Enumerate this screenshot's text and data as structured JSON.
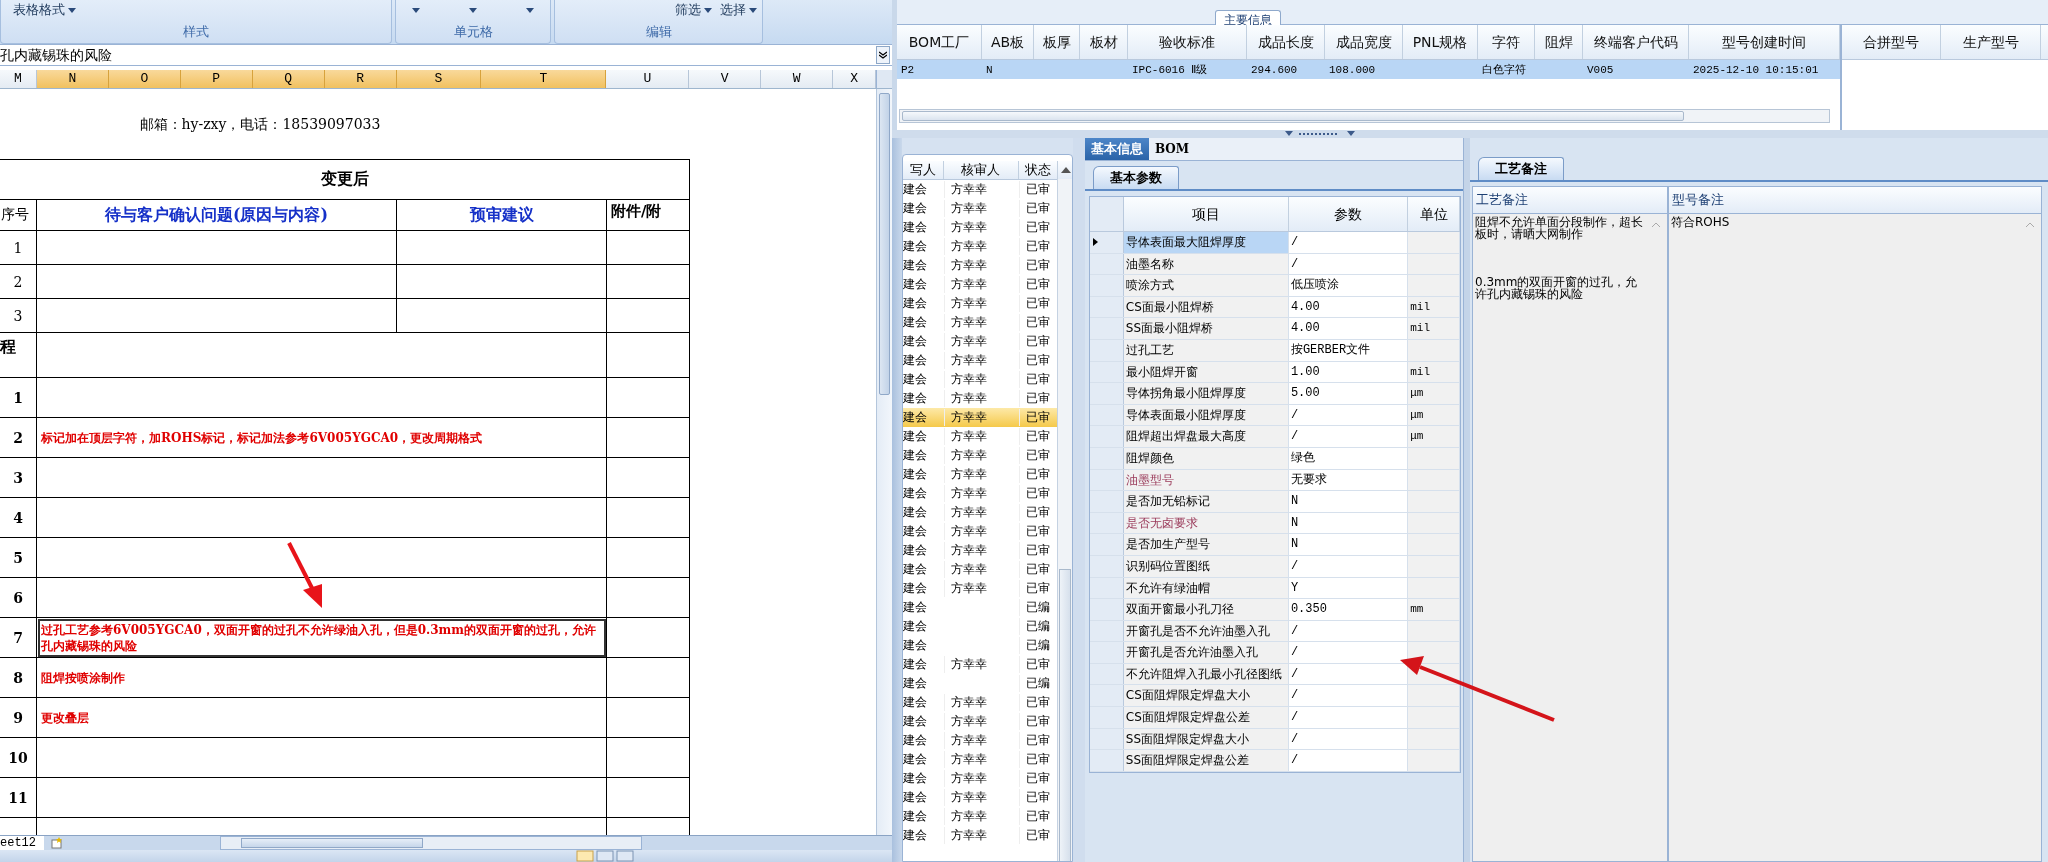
{
  "excel": {
    "ribbon": {
      "groups": [
        {
          "label": "样式",
          "commands": [
            "表格格式"
          ]
        },
        {
          "label": "单元格",
          "kind": "carets"
        },
        {
          "label": "编辑",
          "commands": [
            "筛选",
            "选择"
          ]
        }
      ]
    },
    "formula_bar": {
      "value": "孔内藏锡珠的风险"
    },
    "columns": [
      {
        "label": "M",
        "selected": false
      },
      {
        "label": "N",
        "selected": true
      },
      {
        "label": "O",
        "selected": true
      },
      {
        "label": "P",
        "selected": true
      },
      {
        "label": "Q",
        "selected": true
      },
      {
        "label": "R",
        "selected": true
      },
      {
        "label": "S",
        "selected": true
      },
      {
        "label": "T",
        "selected": true
      },
      {
        "label": "U",
        "selected": false
      },
      {
        "label": "V",
        "selected": false
      },
      {
        "label": "W",
        "selected": false
      },
      {
        "label": "X",
        "selected": false
      }
    ],
    "sheet": {
      "contact": "邮箱：hy-zxy，电话：18539097033",
      "title": "变更后",
      "headers": [
        "序号",
        "待与客户确认问题(原因与内容)",
        "预审建议",
        "附件/附"
      ],
      "confirm_rows": [
        {
          "no": "1"
        },
        {
          "no": "2"
        },
        {
          "no": "3"
        }
      ],
      "section_label": "程",
      "change_rows": [
        {
          "no": "1",
          "selected": false
        },
        {
          "no": "2",
          "text": "标记加在顶层字符，加ROHS标记，标记加法参考6V005YGCA0，更改周期格式",
          "selected": false
        },
        {
          "no": "3",
          "selected": false
        },
        {
          "no": "4",
          "selected": false
        },
        {
          "no": "5",
          "selected": false
        },
        {
          "no": "6",
          "selected": false
        },
        {
          "no": "7",
          "text": "过孔工艺参考6V005YGCA0，双面开窗的过孔不允许绿油入孔，但是0.3mm的双面开窗的过孔，允许孔内藏锡珠的风险",
          "selected": true
        },
        {
          "no": "8",
          "text": "阻焊按喷涂制作",
          "selected": false
        },
        {
          "no": "9",
          "text": "更改叠层",
          "selected": false
        },
        {
          "no": "10",
          "selected": false
        },
        {
          "no": "11",
          "selected": false
        }
      ]
    },
    "sheet_tabs": [
      {
        "label": "eet12",
        "selected": true
      }
    ]
  },
  "main_info": {
    "title": "主要信息",
    "columns": [
      "BOM工厂",
      "AB板",
      "板厚",
      "板材",
      "验收标准",
      "成品长度",
      "成品宽度",
      "PNL规格",
      "字符",
      "阻焊",
      "终端客户代码",
      "型号创建时间"
    ],
    "rows": [
      {
        "selected": true,
        "cells": [
          "P2",
          "N",
          null,
          null,
          "IPC-6016 Ⅱ级",
          "294.600",
          "108.000",
          null,
          "白色字符",
          null,
          "V005",
          "2025-12-10 10:15:01"
        ]
      }
    ],
    "side_columns": [
      "合拼型号",
      "生产型号"
    ]
  },
  "review_list": {
    "columns": [
      "写人",
      "核审人",
      "状态"
    ],
    "rows": [
      {
        "author": "建会",
        "reviewer": "方幸幸",
        "status": "已审",
        "selected": false
      },
      {
        "author": "建会",
        "reviewer": "方幸幸",
        "status": "已审",
        "selected": false
      },
      {
        "author": "建会",
        "reviewer": "方幸幸",
        "status": "已审",
        "selected": false
      },
      {
        "author": "建会",
        "reviewer": "方幸幸",
        "status": "已审",
        "selected": false
      },
      {
        "author": "建会",
        "reviewer": "方幸幸",
        "status": "已审",
        "selected": false
      },
      {
        "author": "建会",
        "reviewer": "方幸幸",
        "status": "已审",
        "selected": false
      },
      {
        "author": "建会",
        "reviewer": "方幸幸",
        "status": "已审",
        "selected": false
      },
      {
        "author": "建会",
        "reviewer": "方幸幸",
        "status": "已审",
        "selected": false
      },
      {
        "author": "建会",
        "reviewer": "方幸幸",
        "status": "已审",
        "selected": false
      },
      {
        "author": "建会",
        "reviewer": "方幸幸",
        "status": "已审",
        "selected": false
      },
      {
        "author": "建会",
        "reviewer": "方幸幸",
        "status": "已审",
        "selected": false
      },
      {
        "author": "建会",
        "reviewer": "方幸幸",
        "status": "已审",
        "selected": false
      },
      {
        "author": "建会",
        "reviewer": "方幸幸",
        "status": "已审",
        "selected": true
      },
      {
        "author": "建会",
        "reviewer": "方幸幸",
        "status": "已审",
        "selected": false
      },
      {
        "author": "建会",
        "reviewer": "方幸幸",
        "status": "已审",
        "selected": false
      },
      {
        "author": "建会",
        "reviewer": "方幸幸",
        "status": "已审",
        "selected": false
      },
      {
        "author": "建会",
        "reviewer": "方幸幸",
        "status": "已审",
        "selected": false
      },
      {
        "author": "建会",
        "reviewer": "方幸幸",
        "status": "已审",
        "selected": false
      },
      {
        "author": "建会",
        "reviewer": "方幸幸",
        "status": "已审",
        "selected": false
      },
      {
        "author": "建会",
        "reviewer": "方幸幸",
        "status": "已审",
        "selected": false
      },
      {
        "author": "建会",
        "reviewer": "方幸幸",
        "status": "已审",
        "selected": false
      },
      {
        "author": "建会",
        "reviewer": "方幸幸",
        "status": "已审",
        "selected": false
      },
      {
        "author": "建会",
        "status": "已编",
        "selected": false
      },
      {
        "author": "建会",
        "status": "已编",
        "selected": false
      },
      {
        "author": "建会",
        "status": "已编",
        "selected": false
      },
      {
        "author": "建会",
        "reviewer": "方幸幸",
        "status": "已审",
        "selected": false
      },
      {
        "author": "建会",
        "status": "已编",
        "selected": false
      },
      {
        "author": "建会",
        "reviewer": "方幸幸",
        "status": "已审",
        "selected": false
      },
      {
        "author": "建会",
        "reviewer": "方幸幸",
        "status": "已审",
        "selected": false
      },
      {
        "author": "建会",
        "reviewer": "方幸幸",
        "status": "已审",
        "selected": false
      },
      {
        "author": "建会",
        "reviewer": "方幸幸",
        "status": "已审",
        "selected": false
      },
      {
        "author": "建会",
        "reviewer": "方幸幸",
        "status": "已审",
        "selected": false
      },
      {
        "author": "建会",
        "reviewer": "方幸幸",
        "status": "已审",
        "selected": false
      },
      {
        "author": "建会",
        "reviewer": "方幸幸",
        "status": "已审",
        "selected": false
      },
      {
        "author": "建会",
        "reviewer": "方幸幸",
        "status": "已审",
        "selected": false
      }
    ]
  },
  "detail_tabs": [
    {
      "label": "基本信息",
      "selected": true
    },
    {
      "label": "BOM",
      "selected": false
    }
  ],
  "param_tab": "基本参数",
  "params": {
    "columns": [
      "项目",
      "参数",
      "单位"
    ],
    "rows": [
      {
        "item": "导体表面最大阻焊厚度",
        "value": "/",
        "selected": true,
        "flagged": false
      },
      {
        "item": "油墨名称",
        "value": "/",
        "selected": false,
        "flagged": false
      },
      {
        "item": "喷涂方式",
        "value": "低压喷涂",
        "selected": false,
        "flagged": false
      },
      {
        "item": "CS面最小阻焊桥",
        "value": "4.00",
        "unit": "mil",
        "selected": false,
        "flagged": false
      },
      {
        "item": "SS面最小阻焊桥",
        "value": "4.00",
        "unit": "mil",
        "selected": false,
        "flagged": false
      },
      {
        "item": "过孔工艺",
        "value": "按GERBER文件",
        "selected": false,
        "flagged": false
      },
      {
        "item": "最小阻焊开窗",
        "value": "1.00",
        "unit": "mil",
        "selected": false,
        "flagged": false
      },
      {
        "item": "导体拐角最小阻焊厚度",
        "value": "5.00",
        "unit": "μm",
        "selected": false,
        "flagged": false
      },
      {
        "item": "导体表面最小阻焊厚度",
        "value": "/",
        "unit": "μm",
        "selected": false,
        "flagged": false
      },
      {
        "item": "阻焊超出焊盘最大高度",
        "value": "/",
        "unit": "μm",
        "selected": false,
        "flagged": false
      },
      {
        "item": "阻焊颜色",
        "value": "绿色",
        "selected": false,
        "flagged": false
      },
      {
        "item": "油墨型号",
        "value": "无要求",
        "selected": false,
        "flagged": true
      },
      {
        "item": "是否加无铅标记",
        "value": "N",
        "selected": false,
        "flagged": false
      },
      {
        "item": "是否无卤要求",
        "value": "N",
        "selected": false,
        "flagged": true
      },
      {
        "item": "是否加生产型号",
        "value": "N",
        "selected": false,
        "flagged": false
      },
      {
        "item": "识别码位置图纸",
        "value": "/",
        "selected": false,
        "flagged": false
      },
      {
        "item": "不允许有绿油帽",
        "value": "Y",
        "selected": false,
        "flagged": false
      },
      {
        "item": "双面开窗最小孔刀径",
        "value": "0.350",
        "unit": "mm",
        "selected": false,
        "flagged": false
      },
      {
        "item": "开窗孔是否不允许油墨入孔",
        "value": "/",
        "selected": false,
        "flagged": false
      },
      {
        "item": "开窗孔是否允许油墨入孔",
        "value": "/",
        "selected": false,
        "flagged": false
      },
      {
        "item": "不允许阻焊入孔最小孔径图纸",
        "value": "/",
        "selected": false,
        "flagged": false
      },
      {
        "item": "CS面阻焊限定焊盘大小",
        "value": "/",
        "selected": false,
        "flagged": false
      },
      {
        "item": "CS面阻焊限定焊盘公差",
        "value": "/",
        "selected": false,
        "flagged": false
      },
      {
        "item": "SS面阻焊限定焊盘大小",
        "value": "/",
        "selected": false,
        "flagged": false
      },
      {
        "item": "SS面阻焊限定焊盘公差",
        "value": "/",
        "selected": false,
        "flagged": false
      }
    ]
  },
  "notes_tab": "工艺备注",
  "notes": {
    "columns": [
      "工艺备注",
      "型号备注"
    ],
    "process_note": [
      "阻焊不允许单面分段制作，超长板时，请晒大网制作",
      "0.3mm的双面开窗的过孔，允许孔内藏锡珠的风险"
    ],
    "model_note": "符合ROHS"
  }
}
